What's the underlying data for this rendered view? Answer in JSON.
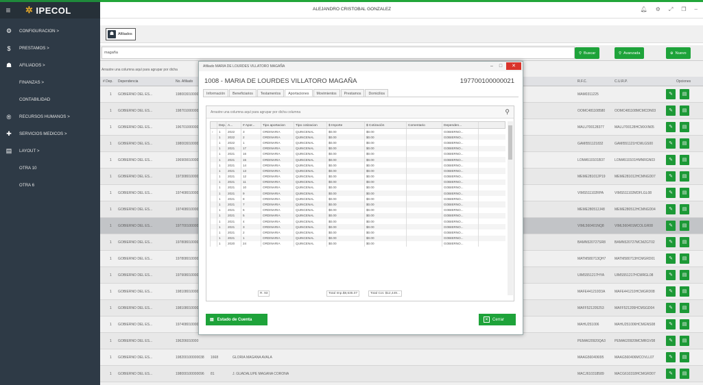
{
  "app": {
    "logo": "IPECOL",
    "user": "ALEJANDRO CRISTOBAL GONZALEZ",
    "tab": "Afiliados"
  },
  "sidebar": {
    "items": [
      {
        "label": "CONFIGURACION  >",
        "icon": "gear-icon",
        "glyph": "⚙",
        "sub": false
      },
      {
        "label": "PRESTAMOS  >",
        "icon": "money-icon",
        "glyph": "$",
        "sub": false
      },
      {
        "label": "AFILIADOS  >",
        "icon": "users-icon",
        "glyph": "☗",
        "sub": false
      },
      {
        "label": "FINANZAS  >",
        "icon": "",
        "glyph": "",
        "sub": true
      },
      {
        "label": "CONTABILIDAD",
        "icon": "",
        "glyph": "",
        "sub": true
      },
      {
        "label": "RECURSOS HUMANOS  >",
        "icon": "registered-icon",
        "glyph": "®",
        "sub": false
      },
      {
        "label": "SERVICIOS MEDICOS  >",
        "icon": "medical-icon",
        "glyph": "✚",
        "sub": false
      },
      {
        "label": "LAYOUT  >",
        "icon": "document-icon",
        "glyph": "▤",
        "sub": false
      },
      {
        "label": "OTRA 10",
        "icon": "",
        "glyph": "",
        "sub": true
      },
      {
        "label": "OTRA 6",
        "icon": "",
        "glyph": "",
        "sub": true
      }
    ]
  },
  "search": {
    "value": "magaña",
    "buscar": "Buscar",
    "avanzada": "Avanzada",
    "nuevo": "Nuevo"
  },
  "grid": {
    "group_hint": "Arrastre una columna aquí para agrupar por dicha",
    "headers": {
      "dep": "# Dep.",
      "dependencia": "Dependencia",
      "afiliado": "No. Afiliado",
      "rfc": "R.F.C.",
      "curp": "C.U.R.P.",
      "opciones": "Opciones"
    },
    "rows": [
      {
        "dep": "1",
        "dependencia": "GOBIERNO DEL ES...",
        "afiliado": "198003010000",
        "num": "",
        "nombre": "",
        "rfc": "MAM0311225",
        "curp": ""
      },
      {
        "dep": "1",
        "dependencia": "GOBIERNO DEL ES...",
        "afiliado": "198701000000",
        "num": "",
        "nombre": "",
        "rfc": "OOMC481108580",
        "curp": "OOMC481108MCMCDN03"
      },
      {
        "dep": "1",
        "dependencia": "GOBIERNO DEL ES...",
        "afiliado": "196701000000",
        "num": "",
        "nombre": "",
        "rfc": "MALU700128377",
        "curp": "MALU700128HCMXXN05"
      },
      {
        "dep": "1",
        "dependencia": "GOBIERNO DEL ES...",
        "afiliado": "198003010000",
        "num": "",
        "nombre": "",
        "rfc": "GAMI551121832",
        "curp": "GAMI551121HCMLGS00"
      },
      {
        "dep": "1",
        "dependencia": "GOBIERNO DEL ES...",
        "afiliado": "196909010000",
        "num": "",
        "nombre": "",
        "rfc": "LOMA510101B37",
        "curp": "LOMA510101HMNRGN03"
      },
      {
        "dep": "1",
        "dependencia": "GOBIERNO DEL ES...",
        "afiliado": "197308010000",
        "num": "",
        "nombre": "",
        "rfc": "MEME281012P19",
        "curp": "MEME281012HCMNGD07"
      },
      {
        "dep": "1",
        "dependencia": "GOBIERNO DEL ES...",
        "afiliado": "197408010000",
        "num": "",
        "nombre": "",
        "rfc": "VIMS511102RPA",
        "curp": "VIMS511102MDFLGL08"
      },
      {
        "dep": "1",
        "dependencia": "GOBIERNO DEL ES...",
        "afiliado": "197408010000",
        "num": "",
        "nombre": "",
        "rfc": "MEME280512J48",
        "curp": "MEME280512HCMNGD04"
      },
      {
        "dep": "1",
        "dependencia": "GOBIERNO DEL ES...",
        "afiliado": "197700100000",
        "num": "",
        "nombre": "",
        "rfc": "VIML560401NQ8",
        "curp": "VIML560401MCOLGR08"
      },
      {
        "dep": "1",
        "dependencia": "GOBIERNO DEL ES...",
        "afiliado": "197808010000",
        "num": "",
        "nombre": "",
        "rfc": "BAMN520727SR8",
        "curp": "BAMN520727MCMZGT02"
      },
      {
        "dep": "1",
        "dependencia": "GOBIERNO DEL ES...",
        "afiliado": "197808010000",
        "num": "",
        "nombre": "",
        "rfc": "MATM580713QH7",
        "curp": "MATM580713HCMGRD01"
      },
      {
        "dep": "1",
        "dependencia": "GOBIERNO DEL ES...",
        "afiliado": "197908010000",
        "num": "",
        "nombre": "",
        "rfc": "UIMS551217HYA",
        "curp": "UIMS551217HCMRGL08"
      },
      {
        "dep": "1",
        "dependencia": "GOBIERNO DEL ES...",
        "afiliado": "198108010000",
        "num": "",
        "nombre": "",
        "rfc": "MAFE441210D3A",
        "curp": "MAFE441210HCMGRD08"
      },
      {
        "dep": "1",
        "dependencia": "GOBIERNO DEL ES...",
        "afiliado": "198108010000",
        "num": "",
        "nombre": "",
        "rfc": "MAFF521205253",
        "curp": "MAFF521205HCMSGD04"
      },
      {
        "dep": "1",
        "dependencia": "GOBIERNO DEL ES...",
        "afiliado": "197408010000",
        "num": "",
        "nombre": "",
        "rfc": "MAHU251006",
        "curp": "MAHU251006HCMGNS08"
      },
      {
        "dep": "1",
        "dependencia": "GOBIERNO DEL ES...",
        "afiliado": "196206010000",
        "num": "",
        "nombre": "",
        "rfc": "PEMA620920QA3",
        "curp": "PEMA620920MCMRGV08"
      },
      {
        "dep": "1",
        "dependencia": "GOBIERNO DEL ES...",
        "afiliado": "198200100000038",
        "num": "1668",
        "nombre": "GLORIA MAGAÑA AVALA",
        "rfc": "MAAG560406I95",
        "curp": "MAAG560406MCOVLL07"
      },
      {
        "dep": "1",
        "dependencia": "GOBIERNO DEL ES...",
        "afiliado": "198000100000096",
        "num": "81",
        "nombre": "J. GUADALUPE MAGAÑA CORONA",
        "rfc": "MACJ610318589",
        "curp": "MACG610318HCMGRD07"
      }
    ]
  },
  "modal": {
    "window_title": "Afiliado MARIA DE LOURDES VILLATORO MAGAÑA",
    "header_name": "1008 - MARIA DE LOURDES VILLATORO MAGAÑA",
    "header_number": "197700100000021",
    "tabs": [
      "Información",
      "Beneficiarios",
      "Testamentos",
      "Aportaciones",
      "Movimientos",
      "Prestamos",
      "Domicilios"
    ],
    "active_tab": "Aportaciones",
    "group_hint": "Arrastre una columna aquí para agrupar por dicha columna",
    "columns": [
      "Dep.",
      "A...",
      "# Apor...",
      "Tipo aportacion",
      "Tipo cotizacion",
      "$ Importe",
      "$ Cotización",
      "Comentario",
      "Dependen..."
    ],
    "rows": [
      [
        "1",
        "2022",
        "3",
        "ORDINARIA",
        "QUINCENAL",
        "$0.00",
        "$0.00",
        "",
        "GOBIERNO..."
      ],
      [
        "1",
        "2022",
        "2",
        "ORDINARIA",
        "QUINCENAL",
        "$0.00",
        "$0.00",
        "",
        "GOBIERNO..."
      ],
      [
        "1",
        "2022",
        "1",
        "ORDINARIA",
        "QUINCENAL",
        "$0.00",
        "$0.00",
        "",
        "GOBIERNO..."
      ],
      [
        "1",
        "2021",
        "17",
        "ORDINARIA",
        "QUINCENAL",
        "$0.00",
        "$0.00",
        "",
        "GOBIERNO..."
      ],
      [
        "1",
        "2021",
        "16",
        "ORDINARIA",
        "QUINCENAL",
        "$0.00",
        "$0.00",
        "",
        "GOBIERNO..."
      ],
      [
        "1",
        "2021",
        "15",
        "ORDINARIA",
        "QUINCENAL",
        "$0.00",
        "$0.00",
        "",
        "GOBIERNO..."
      ],
      [
        "1",
        "2021",
        "14",
        "ORDINARIA",
        "QUINCENAL",
        "$0.00",
        "$0.00",
        "",
        "GOBIERNO..."
      ],
      [
        "1",
        "2021",
        "13",
        "ORDINARIA",
        "QUINCENAL",
        "$0.00",
        "$0.00",
        "",
        "GOBIERNO..."
      ],
      [
        "1",
        "2021",
        "12",
        "ORDINARIA",
        "QUINCENAL",
        "$0.00",
        "$0.00",
        "",
        "GOBIERNO..."
      ],
      [
        "1",
        "2021",
        "11",
        "ORDINARIA",
        "QUINCENAL",
        "$0.00",
        "$0.00",
        "",
        "GOBIERNO..."
      ],
      [
        "1",
        "2021",
        "10",
        "ORDINARIA",
        "QUINCENAL",
        "$0.00",
        "$0.00",
        "",
        "GOBIERNO..."
      ],
      [
        "1",
        "2021",
        "9",
        "ORDINARIA",
        "QUINCENAL",
        "$0.00",
        "$0.00",
        "",
        "GOBIERNO..."
      ],
      [
        "1",
        "2021",
        "8",
        "ORDINARIA",
        "QUINCENAL",
        "$0.00",
        "$0.00",
        "",
        "GOBIERNO..."
      ],
      [
        "1",
        "2021",
        "7",
        "ORDINARIA",
        "QUINCENAL",
        "$0.00",
        "$0.00",
        "",
        "GOBIERNO..."
      ],
      [
        "1",
        "2021",
        "6",
        "ORDINARIA",
        "QUINCENAL",
        "$0.00",
        "$0.00",
        "",
        "GOBIERNO..."
      ],
      [
        "1",
        "2021",
        "5",
        "ORDINARIA",
        "QUINCENAL",
        "$0.00",
        "$0.00",
        "",
        "GOBIERNO..."
      ],
      [
        "1",
        "2021",
        "4",
        "ORDINARIA",
        "QUINCENAL",
        "$0.00",
        "$0.00",
        "",
        "GOBIERNO..."
      ],
      [
        "1",
        "2021",
        "3",
        "ORDINARIA",
        "QUINCENAL",
        "$0.00",
        "$0.00",
        "",
        "GOBIERNO..."
      ],
      [
        "1",
        "2021",
        "2",
        "ORDINARIA",
        "QUINCENAL",
        "$0.00",
        "$0.00",
        "",
        "GOBIERNO..."
      ],
      [
        "1",
        "2021",
        "1",
        "ORDINARIA",
        "QUINCENAL",
        "$0.00",
        "$0.00",
        "",
        "GOBIERNO..."
      ],
      [
        "1",
        "2020",
        "24",
        "ORDINARIA",
        "QUINCENAL",
        "$0.00",
        "$0.00",
        "",
        "GOBIERNO..."
      ]
    ],
    "footer": {
      "count": "R. 93",
      "total_imp": "Total Imp.$8,635.07",
      "total_cot": "Total Cot. $12,449..."
    },
    "estado_label": "Estado de Cuenta",
    "cerrar_label": "Cerrar"
  },
  "colors": {
    "green": "#1ea33a",
    "sidebar": "#2e3a46",
    "close": "#d9342b"
  }
}
